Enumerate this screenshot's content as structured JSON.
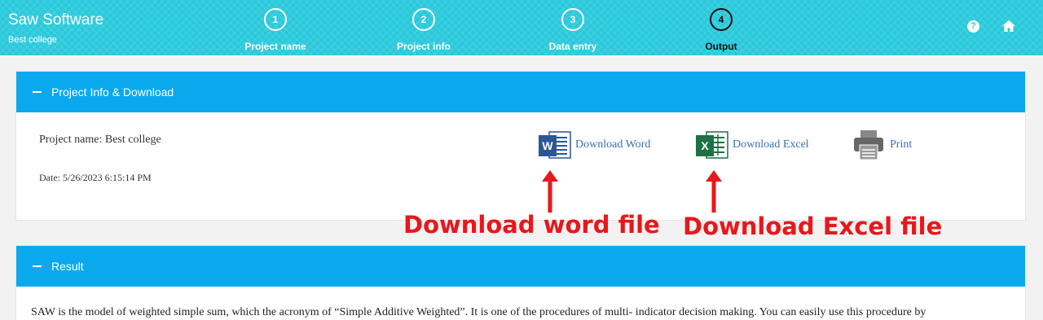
{
  "header": {
    "app_title": "Saw Software",
    "app_subtitle": "Best college",
    "steps": [
      {
        "number": "1",
        "label": "Project name"
      },
      {
        "number": "2",
        "label": "Project info"
      },
      {
        "number": "3",
        "label": "Data entry"
      },
      {
        "number": "4",
        "label": "Output"
      }
    ],
    "active_step": "4",
    "help_icon_glyph": "?",
    "icons": [
      "help-icon",
      "home-icon"
    ],
    "color": "#29c9dc"
  },
  "info_panel": {
    "title": "Project Info & Download",
    "project_name": "Project name: Best college",
    "date": "Date: 5/26/2023 6:15:14 PM",
    "download_word_label": "Download Word",
    "download_excel_label": "Download Excel",
    "print_label": "Print",
    "word_icon_letter": "W",
    "excel_icon_letter": "X",
    "header_color": "#0aa9ee"
  },
  "annotations": {
    "word": "Download word file",
    "excel": "Download Excel file",
    "color": "#e8171b"
  },
  "result_panel": {
    "title": "Result",
    "text": "SAW is the model of weighted simple sum, which the acronym of “Simple Additive Weighted”. It is one of the procedures of multi- indicator decision making. You can easily use this procedure by"
  }
}
